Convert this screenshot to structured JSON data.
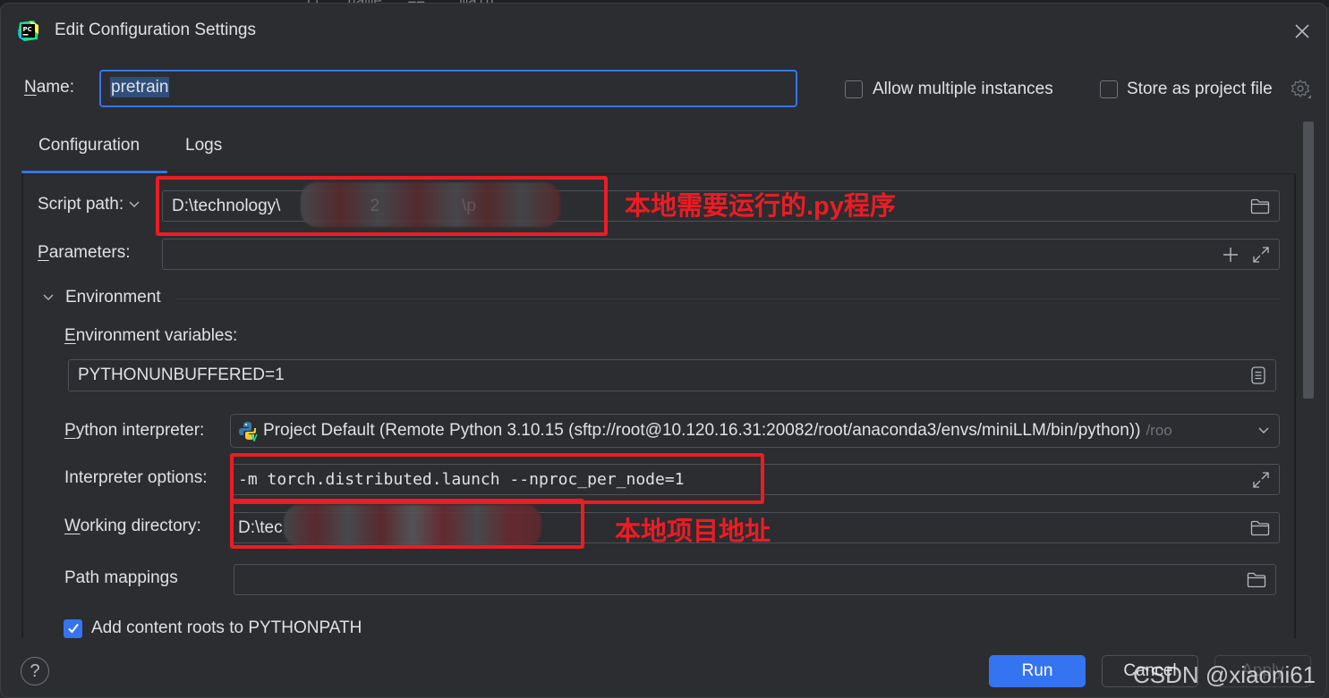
{
  "background": {
    "code_snippet": "if __name__ == '__main__':"
  },
  "window": {
    "title": "Edit Configuration Settings",
    "app_icon": "pycharm-icon",
    "close_icon": "close-icon"
  },
  "name_row": {
    "label": "Name:",
    "value": "pretrain",
    "allow_multiple_label": "Allow multiple instances",
    "allow_multiple_checked": false,
    "store_project_label": "Store as project file",
    "store_project_checked": false,
    "gear_icon": "gear-icon"
  },
  "tabs": [
    {
      "label": "Configuration",
      "active": true
    },
    {
      "label": "Logs",
      "active": false
    }
  ],
  "form": {
    "script_path": {
      "label": "Script path:",
      "value": "D:\\technology\\",
      "value_partial": "2",
      "value_tail": "\\p",
      "icon": "folder-icon"
    },
    "parameters": {
      "label": "Parameters:",
      "value": "",
      "add_icon": "plus-icon",
      "expand_icon": "expand-icon"
    },
    "environment": {
      "section_label": "Environment",
      "expanded": true,
      "env_vars_label": "Environment variables:",
      "env_vars_value": "PYTHONUNBUFFERED=1",
      "env_vars_icon": "document-list-icon"
    },
    "python_interpreter": {
      "label": "Python interpreter:",
      "value": "Project Default (Remote Python 3.10.15 (sftp://root@10.120.16.31:20082/root/anaconda3/envs/miniLLM/bin/python))",
      "suffix": "/roo",
      "icon": "python-icon"
    },
    "interpreter_options": {
      "label": "Interpreter options:",
      "value": "-m torch.distributed.launch --nproc_per_node=1",
      "icon": "expand-icon"
    },
    "working_directory": {
      "label": "Working directory:",
      "value": "D:\\tec",
      "icon": "folder-icon"
    },
    "path_mappings": {
      "label": "Path mappings",
      "value": "",
      "icon": "folder-icon"
    },
    "add_content_roots": {
      "label": "Add content roots to PYTHONPATH",
      "checked": true
    }
  },
  "annotations": {
    "script_note": "本地需要运行的.py程序",
    "workdir_note": "本地项目地址",
    "color": "#ec1c24"
  },
  "footer": {
    "help_label": "?",
    "run_label": "Run",
    "cancel_label": "Cancel",
    "apply_label": "Apply"
  },
  "watermark": "CSDN @xiaoni61",
  "colors": {
    "accent": "#3574f0",
    "background": "#2b2d30",
    "text": "#dfe1e5",
    "border": "#4e5157"
  }
}
